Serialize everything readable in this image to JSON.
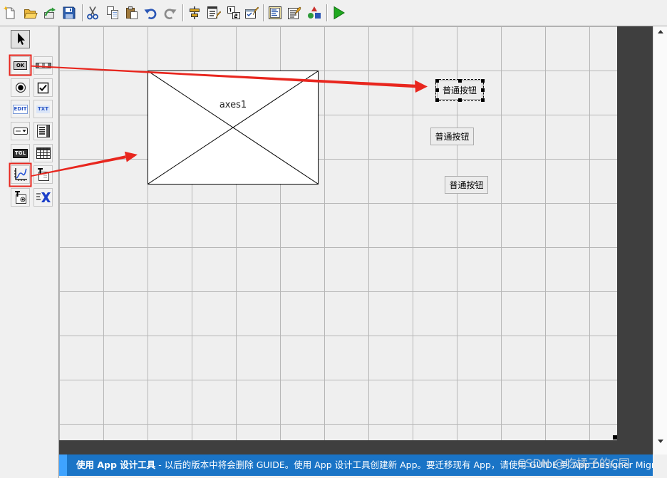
{
  "toolbar": {
    "icons": [
      "new-figure-icon",
      "open-file-icon",
      "edit-icon",
      "save-icon",
      "cut-icon",
      "copy-icon",
      "paste-icon",
      "undo-icon",
      "redo-icon",
      "align-objects-icon",
      "menu-editor-icon",
      "tab-order-editor-icon",
      "toolbar-editor-icon",
      "editor-icon",
      "property-inspector-icon",
      "object-browser-icon",
      "run-figure-icon"
    ]
  },
  "palette": {
    "tools": [
      {
        "icon": "arrow-cursor-icon",
        "active": true
      },
      {
        "icon": "push-button-icon",
        "glyph": "OK"
      },
      {
        "icon": "slider-icon"
      },
      {
        "icon": "radio-button-icon"
      },
      {
        "icon": "checkbox-icon"
      },
      {
        "icon": "edit-text-icon",
        "glyph": "EDIT"
      },
      {
        "icon": "static-text-icon",
        "glyph": "TXT"
      },
      {
        "icon": "popup-menu-icon"
      },
      {
        "icon": "listbox-icon"
      },
      {
        "icon": "toggle-button-icon",
        "glyph": "TGL"
      },
      {
        "icon": "table-icon"
      },
      {
        "icon": "axes-icon"
      },
      {
        "icon": "panel-icon"
      },
      {
        "icon": "button-group-icon"
      },
      {
        "icon": "activex-control-icon"
      }
    ]
  },
  "canvas": {
    "axes": {
      "tag": "axes1"
    },
    "push_buttons": [
      {
        "label": "普通按钮",
        "selected": true
      },
      {
        "label": "普通按钮",
        "selected": false
      },
      {
        "label": "普通按钮",
        "selected": false
      }
    ]
  },
  "banner": {
    "title": "使用 App 设计工具",
    "message": " - 以后的版本中将会删除 GUIDE。使用 App 设计工具创建新 App。要迁移现有 App，请使用 GUIDE 到 App Designer Migration Tool"
  },
  "watermark": "CSDN @吃橘子的C同",
  "colors": {
    "banner": "#1a74c6",
    "banner_accent": "#3ea3ff",
    "annotation_red": "#e8261e",
    "canvas": "#efefef",
    "frame": "#3f3f3f",
    "run_green": "#1fa91f"
  }
}
